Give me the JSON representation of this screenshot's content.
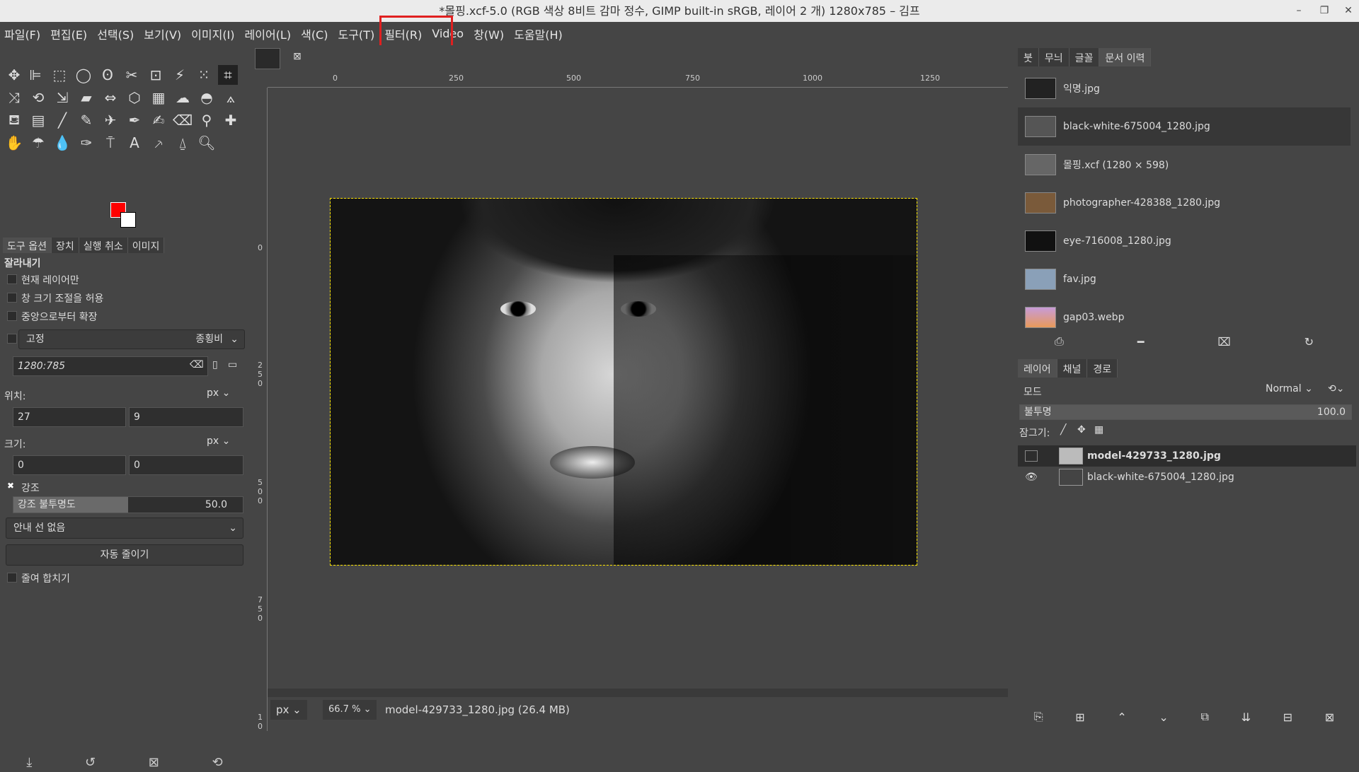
{
  "window": {
    "title": "*몰핑.xcf-5.0 (RGB 색상 8비트 감마 정수, GIMP built-in sRGB, 레이어 2 개) 1280x785 – 김프",
    "minimize": "–",
    "maximize": "❐",
    "close": "✕"
  },
  "menu": [
    "파일(F)",
    "편집(E)",
    "선택(S)",
    "보기(V)",
    "이미지(I)",
    "레이어(L)",
    "색(C)",
    "도구(T)",
    "필터(R)",
    "Video",
    "창(W)",
    "도움말(H)"
  ],
  "left_dock": {
    "tabs": [
      "도구 옵션",
      "장치",
      "실행 취소",
      "이미지"
    ],
    "tool_title": "잘라내기",
    "current_layer_only": "현재 레이어만",
    "allow_grow": "창 크기 조절을 허용",
    "expand_center": "중앙으로부터 확장",
    "fixed": "고정",
    "fixed_mode": "종횡비",
    "ratio_value": "1280:785",
    "position_label": "위치:",
    "position_unit": "px",
    "pos_x": "27",
    "pos_y": "9",
    "size_label": "크기:",
    "size_unit": "px",
    "size_w": "0",
    "size_h": "0",
    "highlight": "강조",
    "highlight_opacity_label": "강조 불투명도",
    "highlight_opacity_value": "50.0",
    "guides": "안내 선 없음",
    "auto_shrink": "자동 줄이기",
    "shrink_merged": "줄여 합치기",
    "fg_color": "#ff0000",
    "bg_color": "#ffffff"
  },
  "canvas": {
    "ruler_labels": [
      "0",
      "250",
      "500",
      "750",
      "1000",
      "1250"
    ],
    "vruler_labels": [
      "0",
      "2 5 0",
      "5 0 0",
      "7 5 0",
      "1 0"
    ],
    "unit": "px",
    "zoom": "66.7 %",
    "status_text": "model-429733_1280.jpg (26.4 MB)"
  },
  "right_dock": {
    "top_tabs": [
      "붓",
      "무늬",
      "글꼴",
      "문서 이력"
    ],
    "documents": [
      {
        "name": "익명.jpg"
      },
      {
        "name": "black-white-675004_1280.jpg"
      },
      {
        "name": "몰핑.xcf (1280 × 598)"
      },
      {
        "name": "photographer-428388_1280.jpg"
      },
      {
        "name": "eye-716008_1280.jpg"
      },
      {
        "name": "fav.jpg"
      },
      {
        "name": "gap03.webp"
      }
    ],
    "layer_tabs": [
      "레이어",
      "채널",
      "경로"
    ],
    "mode_label": "모드",
    "mode_value": "Normal",
    "opacity_label": "불투명",
    "opacity_value": "100.0",
    "lock_label": "잠그기:",
    "layers": [
      {
        "name": "model-429733_1280.jpg",
        "visible": false
      },
      {
        "name": "black-white-675004_1280.jpg",
        "visible": true
      }
    ]
  }
}
